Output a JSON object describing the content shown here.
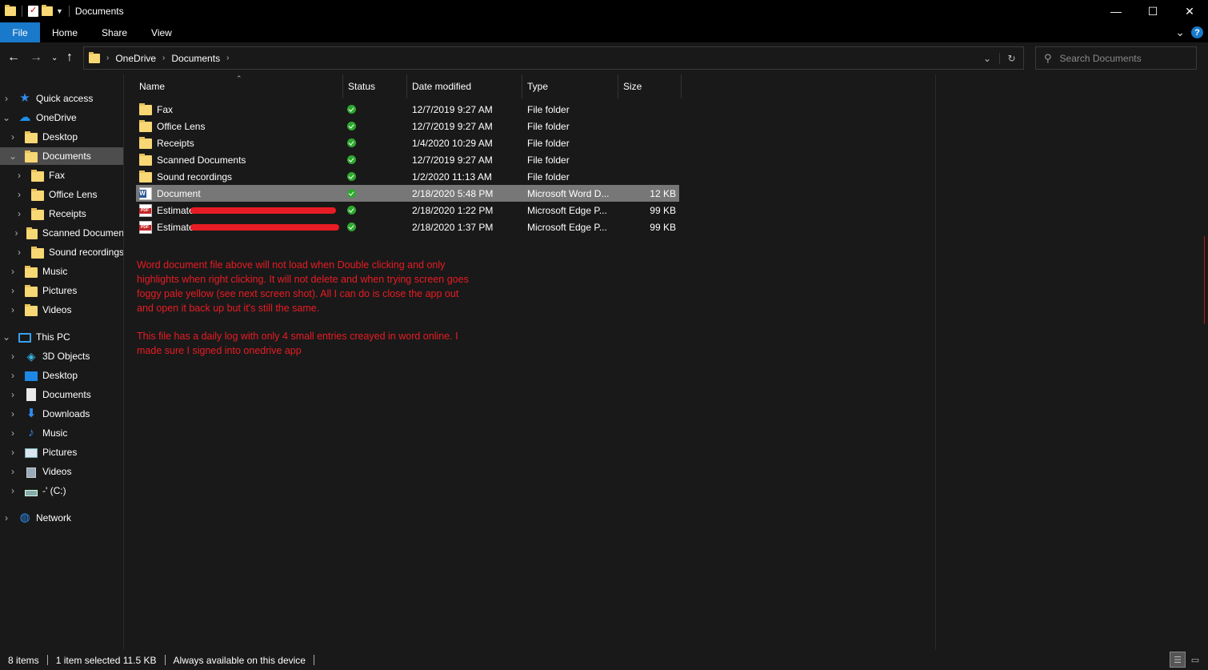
{
  "window": {
    "title": "Documents",
    "controls": {
      "minimize": "—",
      "maximize": "☐",
      "close": "✕"
    }
  },
  "ribbon": {
    "tabs": [
      "File",
      "Home",
      "Share",
      "View"
    ],
    "help": "?",
    "expand": "⌄"
  },
  "address": {
    "crumbs": [
      "OneDrive",
      "Documents"
    ],
    "sep": "›"
  },
  "search": {
    "placeholder": "Search Documents"
  },
  "columns": [
    "Name",
    "Status",
    "Date modified",
    "Type",
    "Size"
  ],
  "files": [
    {
      "name": "Fax",
      "icon": "folder-icon",
      "date": "12/7/2019 9:27 AM",
      "type": "File folder",
      "size": ""
    },
    {
      "name": "Office Lens",
      "icon": "folder-icon",
      "date": "12/7/2019 9:27 AM",
      "type": "File folder",
      "size": ""
    },
    {
      "name": "Receipts",
      "icon": "folder-icon",
      "date": "1/4/2020 10:29 AM",
      "type": "File folder",
      "size": ""
    },
    {
      "name": "Scanned Documents",
      "icon": "folder-icon",
      "date": "12/7/2019 9:27 AM",
      "type": "File folder",
      "size": ""
    },
    {
      "name": "Sound recordings",
      "icon": "folder-icon",
      "date": "1/2/2020 11:13 AM",
      "type": "File folder",
      "size": ""
    },
    {
      "name": "Document",
      "icon": "word-icon",
      "date": "2/18/2020 5:48 PM",
      "type": "Microsoft Word D...",
      "size": "12 KB",
      "selected": true
    },
    {
      "name": "Estimate",
      "icon": "pdf-icon",
      "date": "2/18/2020 1:22 PM",
      "type": "Microsoft Edge P...",
      "size": "99 KB"
    },
    {
      "name": "Estimate",
      "icon": "pdf-icon",
      "date": "2/18/2020 1:37 PM",
      "type": "Microsoft Edge P...",
      "size": "99 KB"
    }
  ],
  "nav": [
    {
      "label": "Quick access",
      "icon": "star-icon",
      "indent": 0,
      "expander": "›"
    },
    {
      "label": "OneDrive",
      "icon": "cloud-icon",
      "indent": 0,
      "expander": "⌄"
    },
    {
      "label": "Desktop",
      "icon": "folder-icon",
      "indent": 1,
      "expander": "›"
    },
    {
      "label": "Documents",
      "icon": "folder-icon",
      "indent": 1,
      "expander": "⌄",
      "selected": true
    },
    {
      "label": "Fax",
      "icon": "folder-icon",
      "indent": 2,
      "expander": "›"
    },
    {
      "label": "Office Lens",
      "icon": "folder-icon",
      "indent": 2,
      "expander": "›"
    },
    {
      "label": "Receipts",
      "icon": "folder-icon",
      "indent": 2,
      "expander": "›"
    },
    {
      "label": "Scanned Documen",
      "icon": "folder-icon",
      "indent": 2,
      "expander": "›"
    },
    {
      "label": "Sound recordings",
      "icon": "folder-icon",
      "indent": 2,
      "expander": "›"
    },
    {
      "label": "Music",
      "icon": "folder-icon",
      "indent": 1,
      "expander": "›"
    },
    {
      "label": "Pictures",
      "icon": "folder-icon",
      "indent": 1,
      "expander": "›"
    },
    {
      "label": "Videos",
      "icon": "folder-icon",
      "indent": 1,
      "expander": "›"
    },
    {
      "label": "This PC",
      "icon": "pc-icon",
      "indent": 0,
      "expander": "⌄",
      "gap": true
    },
    {
      "label": "3D Objects",
      "icon": "cube-icon",
      "indent": 1,
      "expander": "›"
    },
    {
      "label": "Desktop",
      "icon": "desktop-icon",
      "indent": 1,
      "expander": "›"
    },
    {
      "label": "Documents",
      "icon": "document-icon",
      "indent": 1,
      "expander": "›"
    },
    {
      "label": "Downloads",
      "icon": "download-icon",
      "indent": 1,
      "expander": "›"
    },
    {
      "label": "Music",
      "icon": "music-icon",
      "indent": 1,
      "expander": "›"
    },
    {
      "label": "Pictures",
      "icon": "pictures-icon",
      "indent": 1,
      "expander": "›"
    },
    {
      "label": "Videos",
      "icon": "video-icon",
      "indent": 1,
      "expander": "›"
    },
    {
      "label": "-' (C:)",
      "icon": "drive-icon",
      "indent": 1,
      "expander": "›"
    },
    {
      "label": "Network",
      "icon": "network-icon",
      "indent": 0,
      "expander": "›",
      "gap": true
    }
  ],
  "annotation": {
    "para1": "Word document file above will not load when Double clicking and only highlights when right clicking. It will not delete and when trying screen goes foggy pale yellow (see next screen shot). All I can do is close the app out and open it back up but it's still the same.",
    "para2": "This file has a daily log with only 4 small entries creayed in word online. I made sure I signed into onedrive app"
  },
  "statusbar": {
    "count": "8 items",
    "selection": "1 item selected  11.5 KB",
    "availability": "Always available on this device"
  },
  "colors": {
    "accent": "#1979ca",
    "annotation": "#e81c24",
    "synced": "#2ea82e",
    "folder": "#f8d775"
  }
}
